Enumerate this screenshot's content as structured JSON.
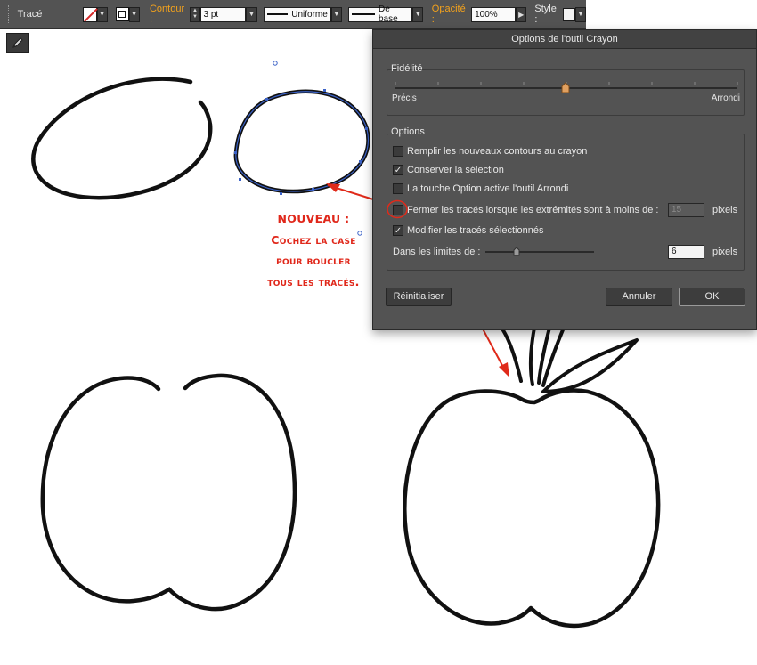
{
  "control_bar": {
    "selection_label": "Tracé",
    "contour_label": "Contour :",
    "stroke_weight": "3 pt",
    "profile_value": "Uniforme",
    "brush_value": "De base",
    "opacity_label": "Opacité :",
    "opacity_value": "100%",
    "style_label": "Style :"
  },
  "dialog": {
    "title": "Options de l'outil Crayon",
    "fidelity": {
      "title": "Fidélité",
      "left_label": "Précis",
      "right_label": "Arrondi",
      "slider_fraction": 0.5
    },
    "options": {
      "title": "Options",
      "fill_new": {
        "label": "Remplir les nouveaux contours au crayon",
        "checked": false
      },
      "keep_selection": {
        "label": "Conserver la sélection",
        "checked": true
      },
      "option_key_smooth": {
        "label": "La touche Option active l'outil Arrondi",
        "checked": false
      },
      "close_paths": {
        "label": "Fermer les tracés lorsque les extrémités sont à moins de :",
        "checked": false,
        "value": "15",
        "unit": "pixels"
      },
      "edit_selected": {
        "label": "Modifier les tracés sélectionnés",
        "checked": true
      },
      "within": {
        "label": "Dans les limites de :",
        "value": "6",
        "unit": "pixels",
        "slider_fraction": 0.3
      }
    },
    "buttons": {
      "reset": "Réinitialiser",
      "cancel": "Annuler",
      "ok": "OK"
    }
  },
  "annotation": {
    "lines": [
      "NOUVEAU :",
      "Cochez la case",
      "pour boucler",
      "tous les tracés."
    ],
    "color": "#e0271a"
  },
  "colors": {
    "panel": "#535353",
    "accent": "#f3a21c",
    "selection_blue": "#3b62c7"
  }
}
